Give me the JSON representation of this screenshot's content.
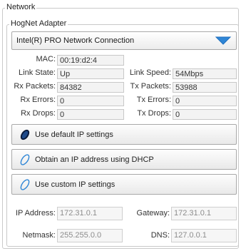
{
  "network_group": {
    "legend": "Network"
  },
  "adapter_group": {
    "legend": "HogNet Adapter",
    "selected_adapter": "Intel(R) PRO  Network Connection"
  },
  "stats": {
    "mac": {
      "label": "MAC:",
      "value": "00:19:d2:4"
    },
    "link_state": {
      "label": "Link State:",
      "value": "Up"
    },
    "link_speed": {
      "label": "Link Speed:",
      "value": "54Mbps"
    },
    "rx_packets": {
      "label": "Rx Packets:",
      "value": "84382"
    },
    "tx_packets": {
      "label": "Tx Packets:",
      "value": "53988"
    },
    "rx_errors": {
      "label": "Rx Errors:",
      "value": "0"
    },
    "tx_errors": {
      "label": "Tx Errors:",
      "value": "0"
    },
    "rx_drops": {
      "label": "Rx Drops:",
      "value": "0"
    },
    "tx_drops": {
      "label": "Tx Drops:",
      "value": "0"
    }
  },
  "ip_modes": [
    {
      "label": "Use default IP settings",
      "selected": true
    },
    {
      "label": "Obtain an IP address using DHCP",
      "selected": false
    },
    {
      "label": "Use custom IP settings",
      "selected": false
    }
  ],
  "ip_config": {
    "ip_address": {
      "label": "IP Address:",
      "value": "172.31.0.1"
    },
    "gateway": {
      "label": "Gateway:",
      "value": "172.31.0.1"
    },
    "netmask": {
      "label": "Netmask:",
      "value": "255.255.0.0"
    },
    "dns": {
      "label": "DNS:",
      "value": "127.0.0.1"
    }
  },
  "colors": {
    "accent_blue": "#2f86d6",
    "radio_selected": "#0a1a3a"
  },
  "icons": {
    "dropdown": "chevron-down-icon",
    "radio_on": "radio-selected-icon",
    "radio_off": "radio-unselected-icon"
  }
}
